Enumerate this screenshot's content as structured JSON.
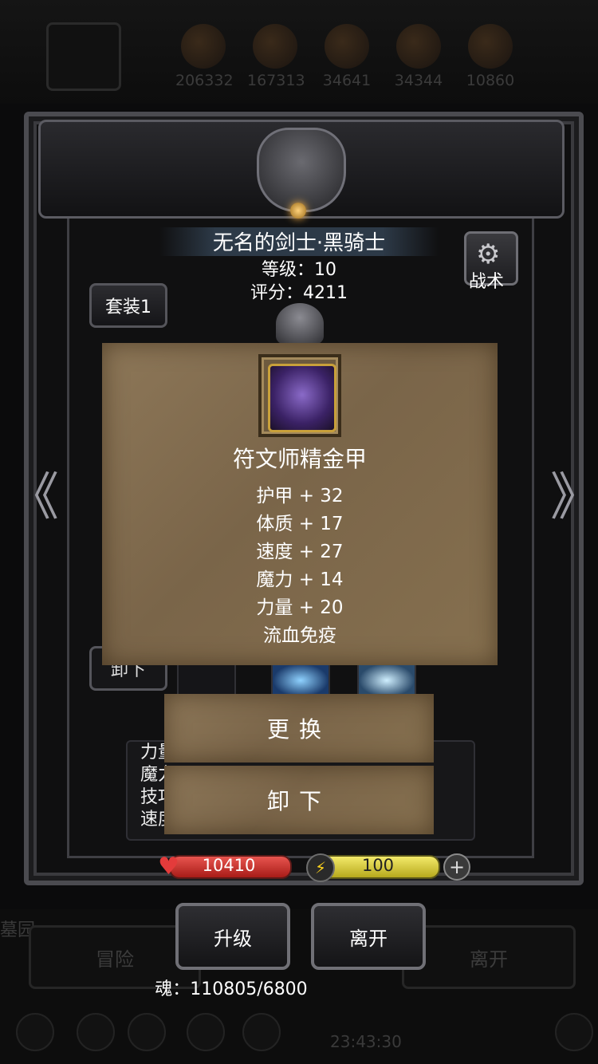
{
  "background": {
    "resources": [
      "206332",
      "167313",
      "34641",
      "34344",
      "10860"
    ],
    "buttons": [
      "冒险",
      "离开"
    ],
    "side_label": "墓园",
    "timer": "23:43:30"
  },
  "character": {
    "name": "无名的剑士·黑骑士",
    "level": "等级：10",
    "score": "评分：4211"
  },
  "tactic_label": "战术",
  "set_label": "套装1",
  "nav": {
    "left": "《",
    "right": "》"
  },
  "unequip_bg_label": "卸下",
  "stats_partial": [
    "力量",
    "魔力",
    "技巧",
    "速度"
  ],
  "item": {
    "name": "符文师精金甲",
    "attributes": [
      "护甲 + 32",
      "体质 + 17",
      "速度 + 27",
      "魔力 + 14",
      "力量 + 20",
      "流血免疫"
    ]
  },
  "actions": {
    "replace": "更换",
    "unequip": "卸下"
  },
  "bars": {
    "hp": "10410",
    "energy": "100",
    "add": "+"
  },
  "buttons": {
    "upgrade": "升级",
    "leave": "离开"
  },
  "soul": "魂：110805/6800",
  "icons": {
    "heart": "heart-icon",
    "bolt": "lightning-icon",
    "gear": "gear-icon"
  }
}
